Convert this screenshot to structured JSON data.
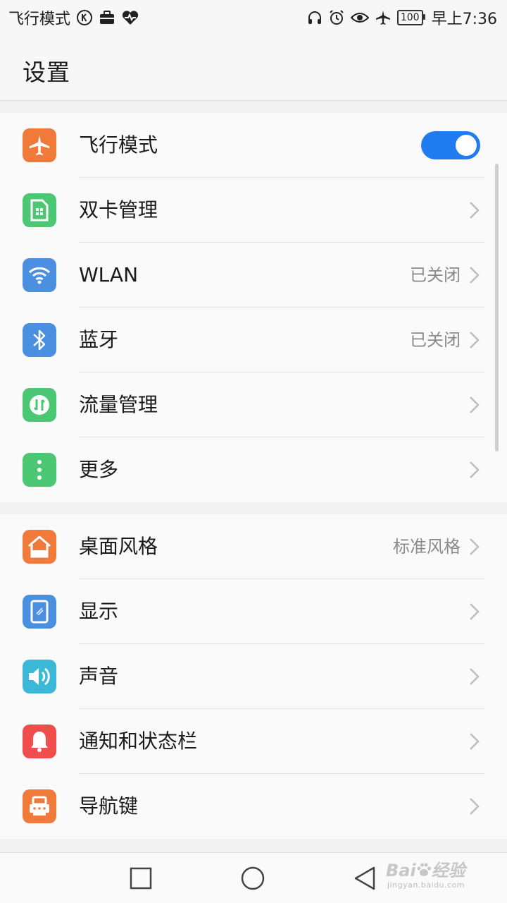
{
  "status_bar": {
    "left_text": "飞行模式",
    "left_icons": [
      "k-circle-icon",
      "briefcase-icon",
      "heart-pulse-icon"
    ],
    "right_icons": [
      "headset-icon",
      "alarm-icon",
      "eye-icon",
      "airplane-icon"
    ],
    "battery": "100",
    "time": "早上7:36"
  },
  "header": {
    "title": "设置"
  },
  "groups": [
    {
      "items": [
        {
          "label": "飞行模式",
          "icon": "airplane-icon",
          "color": "#f07a3a",
          "toggle": true
        },
        {
          "label": "双卡管理",
          "icon": "sim-card-icon",
          "color": "#4cc774"
        },
        {
          "label": "WLAN",
          "icon": "wifi-icon",
          "color": "#4a8fe0",
          "value": "已关闭"
        },
        {
          "label": "蓝牙",
          "icon": "bluetooth-icon",
          "color": "#4a8fe0",
          "value": "已关闭"
        },
        {
          "label": "流量管理",
          "icon": "data-usage-icon",
          "color": "#4cc774"
        },
        {
          "label": "更多",
          "icon": "more-icon",
          "color": "#4cc774"
        }
      ]
    },
    {
      "items": [
        {
          "label": "桌面风格",
          "icon": "home-icon",
          "color": "#f07a3a",
          "value": "标准风格"
        },
        {
          "label": "显示",
          "icon": "display-icon",
          "color": "#4a8fe0"
        },
        {
          "label": "声音",
          "icon": "sound-icon",
          "color": "#3bb8d8"
        },
        {
          "label": "通知和状态栏",
          "icon": "bell-icon",
          "color": "#f04d4d"
        },
        {
          "label": "导航键",
          "icon": "navigation-key-icon",
          "color": "#f07a3a"
        }
      ]
    }
  ],
  "watermark": {
    "brand": "Bai",
    "brand2": "经验",
    "url": "jingyan.baidu.com"
  }
}
